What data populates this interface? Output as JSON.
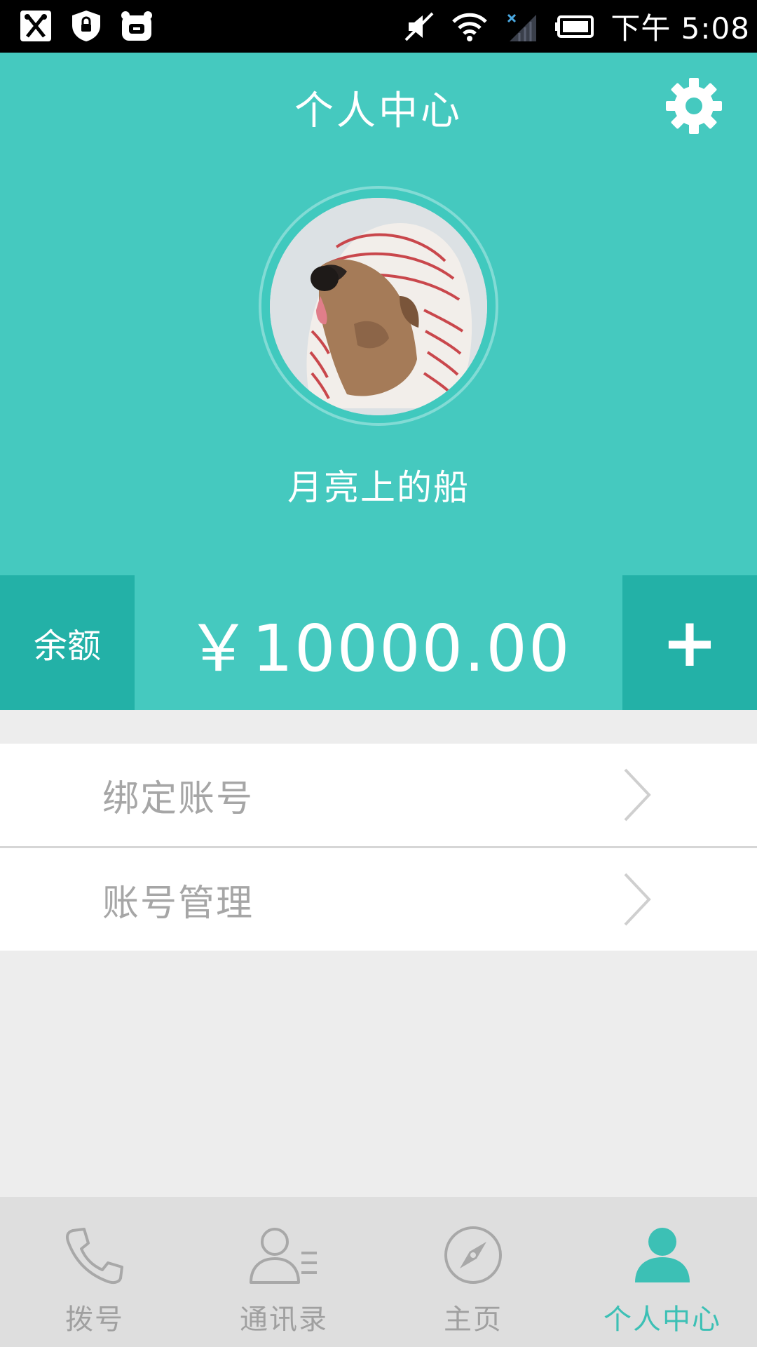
{
  "status_bar": {
    "time": "下午 5:08",
    "icons": [
      "scissors-app-icon",
      "shield-app-icon",
      "bear-app-icon",
      "mute-icon",
      "wifi-icon",
      "no-signal-icon",
      "battery-icon"
    ]
  },
  "header": {
    "title": "个人中心",
    "settings_icon": "gear-icon",
    "username": "月亮上的船",
    "background_color": "#45c9bf"
  },
  "balance": {
    "label": "余额",
    "amount": "￥10000.00",
    "add_label": "+"
  },
  "menu": {
    "items": [
      {
        "label": "绑定账号",
        "icon": "chevron-right-icon"
      },
      {
        "label": "账号管理",
        "icon": "chevron-right-icon"
      }
    ]
  },
  "bottom_nav": {
    "items": [
      {
        "label": "拨号",
        "icon": "phone-icon",
        "active": false
      },
      {
        "label": "通讯录",
        "icon": "contacts-icon",
        "active": false
      },
      {
        "label": "主页",
        "icon": "compass-icon",
        "active": false
      },
      {
        "label": "个人中心",
        "icon": "person-icon",
        "active": true
      }
    ],
    "active_color": "#3cc0b5",
    "inactive_color": "#a0a0a0"
  }
}
